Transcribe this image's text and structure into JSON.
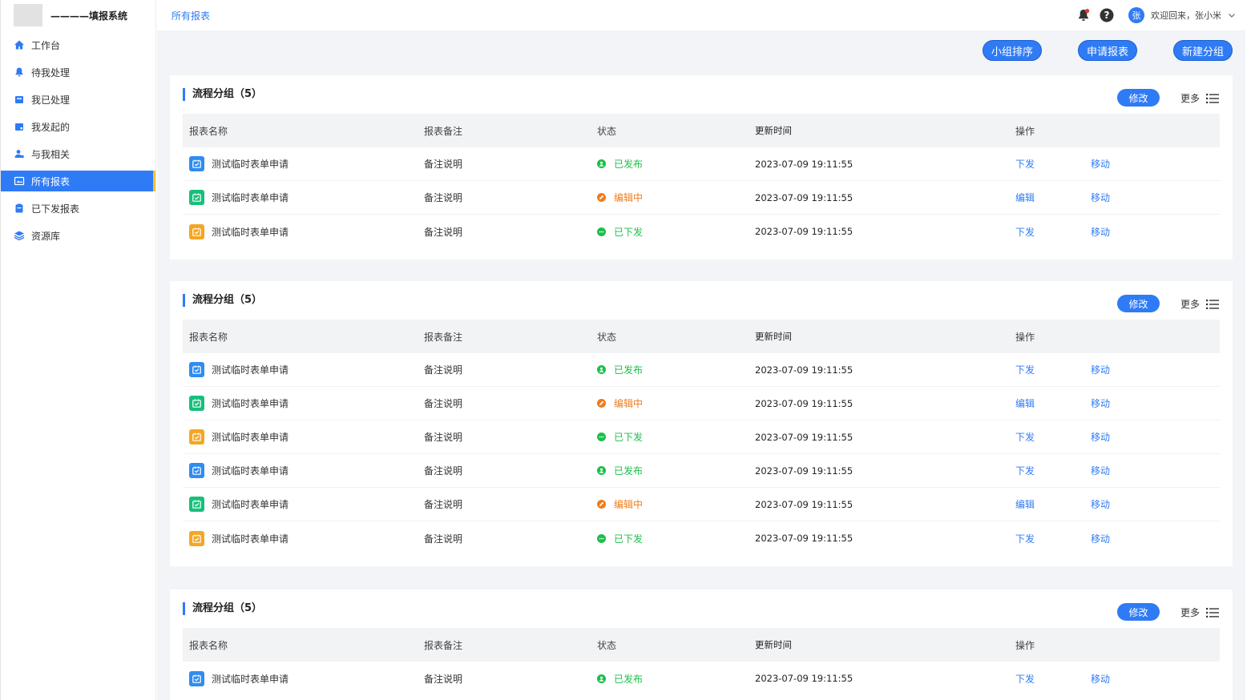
{
  "app": {
    "title": "————填报系统"
  },
  "topbar": {
    "breadcrumb": "所有报表",
    "avatar_text": "张",
    "welcome": "欢迎回来，张小米"
  },
  "sidebar": {
    "items": [
      {
        "label": "工作台",
        "icon": "home-icon",
        "active": false
      },
      {
        "label": "待我处理",
        "icon": "bell-icon",
        "active": false
      },
      {
        "label": "我已处理",
        "icon": "inbox-icon",
        "active": false
      },
      {
        "label": "我发起的",
        "icon": "folder-icon",
        "active": false
      },
      {
        "label": "与我相关",
        "icon": "user-icon",
        "active": false
      },
      {
        "label": "所有报表",
        "icon": "image-icon",
        "active": true
      },
      {
        "label": "已下发报表",
        "icon": "clipboard-icon",
        "active": false
      },
      {
        "label": "资源库",
        "icon": "layers-icon",
        "active": false
      }
    ]
  },
  "actions": {
    "sort_group": "小组排序",
    "apply_report": "申请报表",
    "new_group": "新建分组"
  },
  "colors": {
    "accent": "#2f7bf5",
    "published": "#1cbf4a",
    "editing": "#f07c1a",
    "issued": "#1cbf4a"
  },
  "table_headers": {
    "name": "报表名称",
    "note": "报表备注",
    "status": "状态",
    "time": "更新时间",
    "op": "操作"
  },
  "groups": [
    {
      "title": "流程分组（5）",
      "edit": "修改",
      "more": "更多",
      "rows": [
        {
          "name": "测试临时表单申请",
          "note": "备注说明",
          "status": "已发布",
          "status_key": "published",
          "icon_color": "blue",
          "time": "2023-07-09  19:11:55",
          "op1": "下发",
          "op2": "移动"
        },
        {
          "name": "测试临时表单申请",
          "note": "备注说明",
          "status": "编辑中",
          "status_key": "editing",
          "icon_color": "green",
          "time": "2023-07-09  19:11:55",
          "op1": "编辑",
          "op2": "移动"
        },
        {
          "name": "测试临时表单申请",
          "note": "备注说明",
          "status": "已下发",
          "status_key": "issued",
          "icon_color": "orange",
          "time": "2023-07-09  19:11:55",
          "op1": "下发",
          "op2": "移动"
        }
      ]
    },
    {
      "title": "流程分组（5）",
      "edit": "修改",
      "more": "更多",
      "rows": [
        {
          "name": "测试临时表单申请",
          "note": "备注说明",
          "status": "已发布",
          "status_key": "published",
          "icon_color": "blue",
          "time": "2023-07-09  19:11:55",
          "op1": "下发",
          "op2": "移动"
        },
        {
          "name": "测试临时表单申请",
          "note": "备注说明",
          "status": "编辑中",
          "status_key": "editing",
          "icon_color": "green",
          "time": "2023-07-09  19:11:55",
          "op1": "编辑",
          "op2": "移动"
        },
        {
          "name": "测试临时表单申请",
          "note": "备注说明",
          "status": "已下发",
          "status_key": "issued",
          "icon_color": "orange",
          "time": "2023-07-09  19:11:55",
          "op1": "下发",
          "op2": "移动"
        },
        {
          "name": "测试临时表单申请",
          "note": "备注说明",
          "status": "已发布",
          "status_key": "published",
          "icon_color": "blue",
          "time": "2023-07-09  19:11:55",
          "op1": "下发",
          "op2": "移动"
        },
        {
          "name": "测试临时表单申请",
          "note": "备注说明",
          "status": "编辑中",
          "status_key": "editing",
          "icon_color": "green",
          "time": "2023-07-09  19:11:55",
          "op1": "编辑",
          "op2": "移动"
        },
        {
          "name": "测试临时表单申请",
          "note": "备注说明",
          "status": "已下发",
          "status_key": "issued",
          "icon_color": "orange",
          "time": "2023-07-09  19:11:55",
          "op1": "下发",
          "op2": "移动"
        }
      ]
    },
    {
      "title": "流程分组（5）",
      "edit": "修改",
      "more": "更多",
      "rows": [
        {
          "name": "测试临时表单申请",
          "note": "备注说明",
          "status": "已发布",
          "status_key": "published",
          "icon_color": "blue",
          "time": "2023-07-09  19:11:55",
          "op1": "下发",
          "op2": "移动"
        }
      ]
    }
  ]
}
